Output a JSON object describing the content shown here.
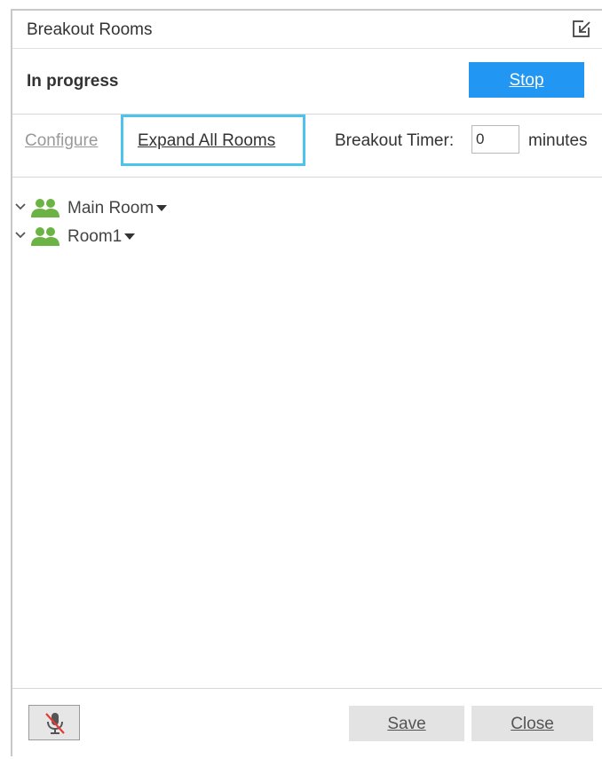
{
  "dialog": {
    "title": "Breakout Rooms",
    "status": "In progress",
    "stop_label": "Stop"
  },
  "toolbar": {
    "configure_label": "Configure",
    "expand_label": "Expand All Rooms",
    "timer_label": "Breakout Timer:",
    "timer_value": "0",
    "timer_unit": "minutes"
  },
  "rooms": [
    {
      "label": "Main Room"
    },
    {
      "label": "Room1"
    }
  ],
  "footer": {
    "save_label": "Save",
    "close_label": "Close"
  },
  "colors": {
    "accent": "#2196f3",
    "highlight_border": "#4dc2ea",
    "room_icon": "#6ab344",
    "mute_slash": "#e53935"
  },
  "icons": [
    "popout-icon",
    "chevron-down-icon",
    "people-icon",
    "dropdown-caret-icon",
    "mic-muted-icon"
  ]
}
